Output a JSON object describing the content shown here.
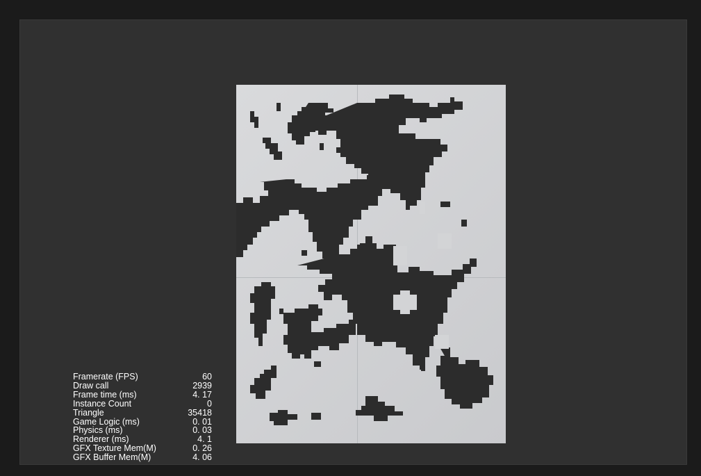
{
  "colors": {
    "outer_background": "#1b1b1b",
    "viewport_background": "#303030",
    "board_light": "#d9dadc",
    "board_shade": "#c9cacd",
    "terrain_fill": "#2c2c2c",
    "stats_text": "#ffffff"
  },
  "stats": [
    {
      "label": "Framerate (FPS)",
      "value": "60"
    },
    {
      "label": "Draw call",
      "value": "2939"
    },
    {
      "label": "Frame time (ms)",
      "value": "4. 17"
    },
    {
      "label": "Instance Count",
      "value": "0"
    },
    {
      "label": "Triangle",
      "value": "35418"
    },
    {
      "label": "Game Logic (ms)",
      "value": "0. 01"
    },
    {
      "label": "Physics (ms)",
      "value": "0. 03"
    },
    {
      "label": "Renderer (ms)",
      "value": "4. 1"
    },
    {
      "label": "GFX Texture Mem(M)",
      "value": "0. 26"
    },
    {
      "label": "GFX Buffer Mem(M)",
      "value": "4. 06"
    }
  ]
}
